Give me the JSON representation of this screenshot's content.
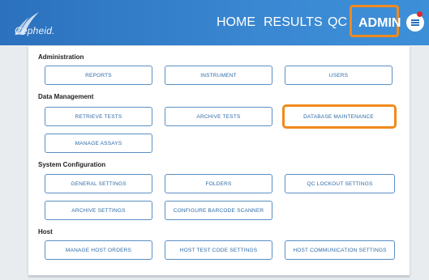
{
  "header": {
    "logo_text": "Cepheid.",
    "nav": [
      "HOME",
      "RESULTS",
      "QC",
      "ADMIN"
    ],
    "active_nav": "ADMIN",
    "accent_color": "#2b71bd",
    "highlight_color": "#f08a1c",
    "notification_dot_color": "#e0262b"
  },
  "sections": [
    {
      "title": "Administration",
      "buttons": [
        "REPORTS",
        "INSTRUMENT",
        "USERS"
      ]
    },
    {
      "title": "Data Management",
      "buttons": [
        "RETRIEVE TESTS",
        "ARCHIVE TESTS",
        "DATABASE MAINTENANCE",
        "MANAGE ASSAYS"
      ]
    },
    {
      "title": "System Configuration",
      "buttons": [
        "GENERAL SETTINGS",
        "FOLDERS",
        "QC LOCKOUT SETTINGS",
        "ARCHIVE SETTINGS",
        "CONFIGURE BARCODE SCANNER"
      ]
    },
    {
      "title": "Host",
      "buttons": [
        "MANAGE HOST ORDERS",
        "HOST TEST CODE SETTINGS",
        "HOST COMMUNICATION SETTINGS"
      ]
    }
  ],
  "highlighted_button": "DATABASE MAINTENANCE"
}
